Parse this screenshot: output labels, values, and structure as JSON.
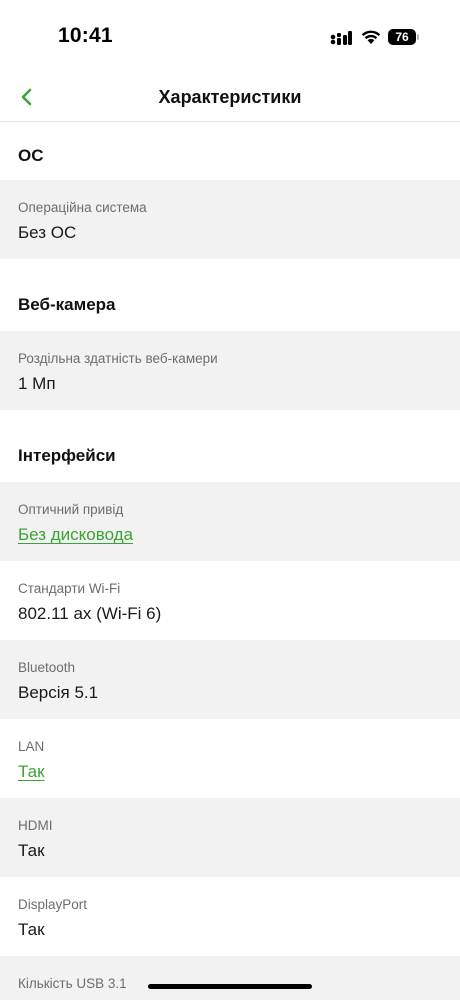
{
  "status_bar": {
    "time": "10:41",
    "battery": "76"
  },
  "nav": {
    "title": "Характеристики",
    "back_icon": "chevron-left-icon",
    "accent_color": "#3aa335"
  },
  "sections": [
    {
      "title": "ОС",
      "rows": [
        {
          "label": "Операційна система",
          "value": "Без ОС",
          "link": false
        }
      ]
    },
    {
      "title": "Веб-камера",
      "rows": [
        {
          "label": "Роздільна здатність веб-камери",
          "value": "1 Мп",
          "link": false
        }
      ]
    },
    {
      "title": "Інтерфейси",
      "rows": [
        {
          "label": "Оптичний привід",
          "value": "Без дисковода",
          "link": true
        },
        {
          "label": "Стандарти Wi-Fi",
          "value": "802.11 ax (Wi-Fi 6)",
          "link": false
        },
        {
          "label": "Bluetooth",
          "value": "Версія 5.1",
          "link": false
        },
        {
          "label": "LAN",
          "value": "Так",
          "link": true
        },
        {
          "label": "HDMI",
          "value": "Так",
          "link": false
        },
        {
          "label": "DisplayPort",
          "value": "Так",
          "link": false
        },
        {
          "label": "Кількість USB 3.1",
          "value": "",
          "link": false
        }
      ]
    }
  ]
}
